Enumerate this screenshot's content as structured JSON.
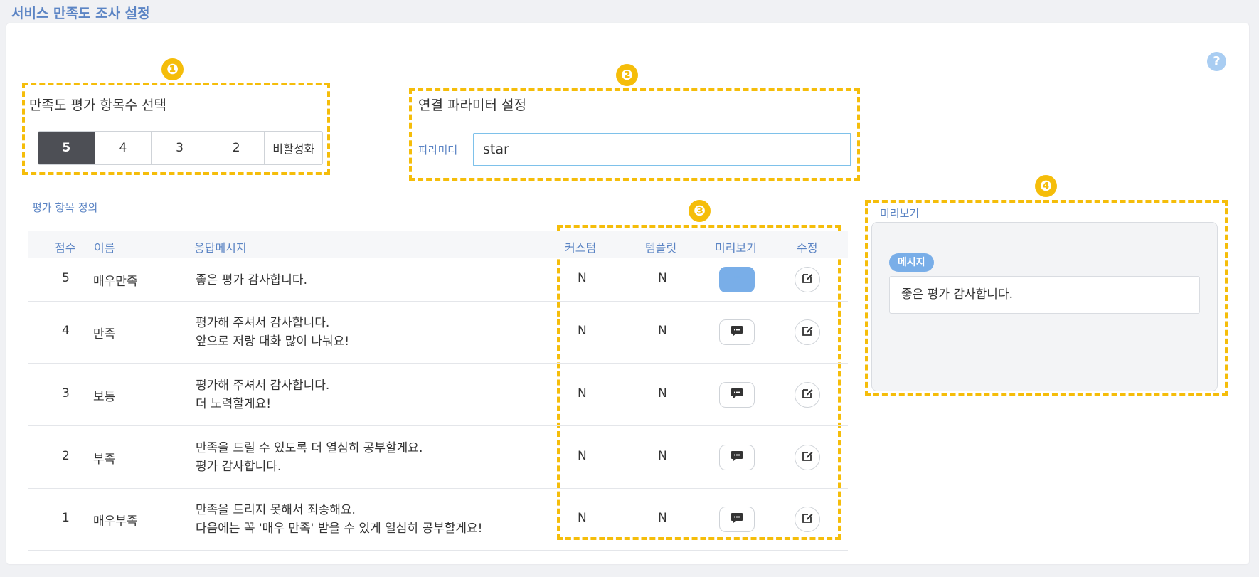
{
  "page": {
    "title": "서비스 만족도 조사 설정"
  },
  "help": {
    "icon": "?"
  },
  "markers": [
    "❶",
    "❷",
    "❸",
    "❹"
  ],
  "count_select": {
    "label": "만족도 평가 항목수 선택",
    "options": [
      "5",
      "4",
      "3",
      "2",
      "비활성화"
    ],
    "selected": "5"
  },
  "parameter": {
    "section_label": "연결 파라미터 설정",
    "field_label": "파라미터",
    "value": "star"
  },
  "definition": {
    "label": "평가 항목 정의",
    "columns": [
      "점수",
      "이름",
      "응답메시지",
      "커스텀",
      "템플릿",
      "미리보기",
      "수정"
    ],
    "rows": [
      {
        "score": "5",
        "name": "매우만족",
        "message": [
          "좋은 평가 감사합니다."
        ],
        "custom": "N",
        "template": "N",
        "preview_active": true
      },
      {
        "score": "4",
        "name": "만족",
        "message": [
          "평가해 주셔서 감사합니다.",
          "앞으로 저랑 대화 많이 나눠요!"
        ],
        "custom": "N",
        "template": "N",
        "preview_active": false
      },
      {
        "score": "3",
        "name": "보통",
        "message": [
          "평가해 주셔서 감사합니다.",
          "더 노력할게요!"
        ],
        "custom": "N",
        "template": "N",
        "preview_active": false
      },
      {
        "score": "2",
        "name": "부족",
        "message": [
          "만족을 드릴 수 있도록 더 열심히 공부할게요.",
          "평가 감사합니다."
        ],
        "custom": "N",
        "template": "N",
        "preview_active": false
      },
      {
        "score": "1",
        "name": "매우부족",
        "message": [
          "만족을 드리지 못해서 죄송해요.",
          "다음에는 꼭 '매우 만족' 받을 수 있게 열심히 공부할게요!"
        ],
        "custom": "N",
        "template": "N",
        "preview_active": false
      }
    ]
  },
  "preview": {
    "title": "미리보기",
    "badge": "메시지",
    "message": "좋은 평가 감사합니다."
  },
  "colors": {
    "accent": "#5b84c4",
    "highlight": "#f5bd0a",
    "preview_active": "#79aee8",
    "selected_segment": "#4d4f55"
  },
  "icons": {
    "preview": "chat-bubble-icon",
    "edit": "edit-icon",
    "help": "help-icon"
  }
}
